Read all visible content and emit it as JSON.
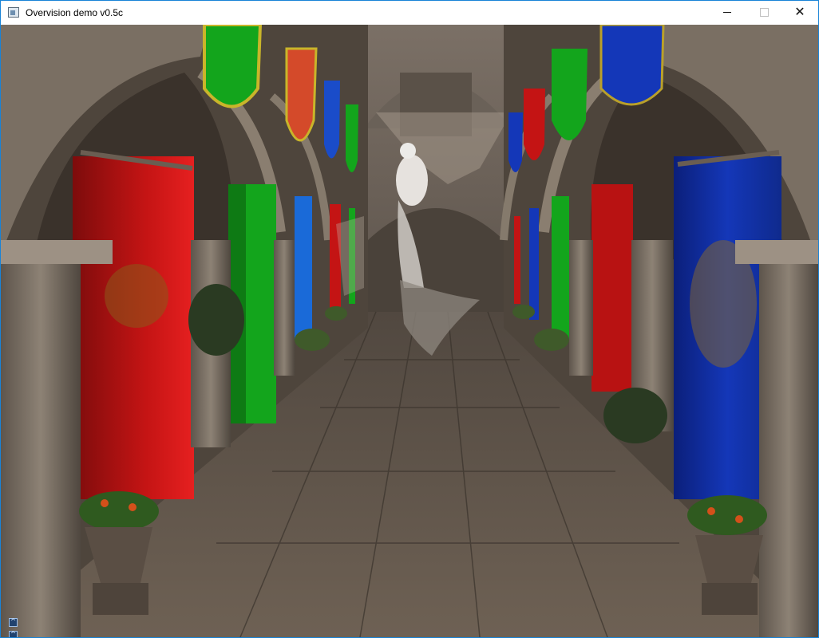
{
  "window": {
    "title": "Overvision demo v0.5c",
    "icons": {
      "app": "app-window-icon",
      "minimize": "minimize-icon",
      "maximize": "maximize-icon",
      "close": "close-icon",
      "close_glyph": "✕"
    }
  },
  "overlay_controls": [
    {
      "name": "collapse-panel-button-1",
      "icon": "chevron-up-icon",
      "glyph": "^"
    },
    {
      "name": "collapse-panel-button-2",
      "icon": "chevron-up-icon",
      "glyph": "^"
    },
    {
      "name": "help-button",
      "icon": "help-icon",
      "glyph": "?"
    }
  ],
  "colors": {
    "titlebar": "#ffffff",
    "window_border": "#1883d7",
    "banner_red": "#c41414",
    "banner_green": "#13a51c",
    "banner_blue": "#1437b8",
    "stone": "#8a7c6c"
  }
}
